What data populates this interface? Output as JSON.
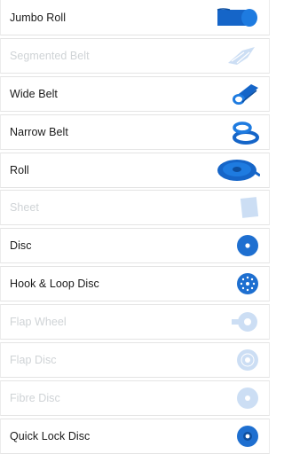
{
  "colors": {
    "accent": "#1e6fd0",
    "disabled_text": "#cfd3d6",
    "text": "#1a1a1a"
  },
  "items": [
    {
      "label": "Jumbo Roll",
      "icon": "jumbo-roll-icon",
      "enabled": true
    },
    {
      "label": "Segmented Belt",
      "icon": "segmented-belt-icon",
      "enabled": false
    },
    {
      "label": "Wide Belt",
      "icon": "wide-belt-icon",
      "enabled": true
    },
    {
      "label": "Narrow Belt",
      "icon": "narrow-belt-icon",
      "enabled": true
    },
    {
      "label": "Roll",
      "icon": "roll-icon",
      "enabled": true
    },
    {
      "label": "Sheet",
      "icon": "sheet-icon",
      "enabled": false
    },
    {
      "label": "Disc",
      "icon": "disc-icon",
      "enabled": true
    },
    {
      "label": "Hook & Loop Disc",
      "icon": "hook-loop-disc-icon",
      "enabled": true
    },
    {
      "label": "Flap Wheel",
      "icon": "flap-wheel-icon",
      "enabled": false
    },
    {
      "label": "Flap Disc",
      "icon": "flap-disc-icon",
      "enabled": false
    },
    {
      "label": "Fibre Disc",
      "icon": "fibre-disc-icon",
      "enabled": false
    },
    {
      "label": "Quick Lock Disc",
      "icon": "quick-lock-disc-icon",
      "enabled": true
    }
  ]
}
